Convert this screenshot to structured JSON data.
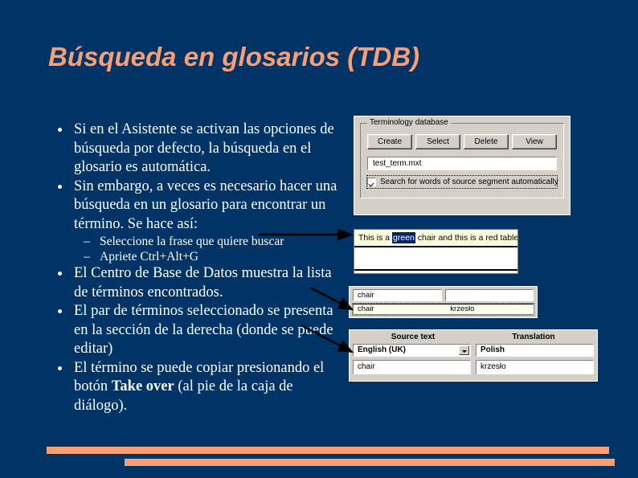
{
  "slide": {
    "title": "Búsqueda en glosarios (TDB)",
    "background_color": "#003366",
    "accent_color": "#FA9E73",
    "body_text_color": "#FFFFFF"
  },
  "body": {
    "bullets": [
      {
        "level": 1,
        "text": "Si en el Asistente se activan las opciones de búsqueda por defecto, la búsqueda en el glosario es automática."
      },
      {
        "level": 1,
        "text": "Sin embargo, a veces es necesario hacer una búsqueda en un glosario para encontrar un término. Se hace así:"
      },
      {
        "level": 2,
        "dash": "–",
        "text": "Seleccione la frase que quiere buscar"
      },
      {
        "level": 2,
        "dash": "–",
        "text": "Apriete Ctrl+Alt+G"
      },
      {
        "level": 1,
        "text": "El Centro de Base de Datos muestra la lista de términos encontrados."
      },
      {
        "level": 1,
        "text": "El par de términos seleccionado se presenta en la sección de la derecha (donde se puede editar)"
      },
      {
        "level": 1,
        "text_before": "El término se puede copiar presionando el botón ",
        "text_bold": "Take over",
        "text_after": " (al pie de la caja de diálogo)."
      }
    ]
  },
  "panel_termdb": {
    "group_legend": "Terminology database",
    "buttons": [
      {
        "label": "Create"
      },
      {
        "label": "Select"
      },
      {
        "label": "Delete"
      },
      {
        "label": "View"
      }
    ],
    "field_value": "test_term.mxt",
    "checkbox_label": "Search for words of source segment automatically",
    "checkbox_checked": true
  },
  "panel_segment": {
    "text_before": "This is a ",
    "text_selected": "green",
    "text_after": " chair and this is a red table",
    "selection_color": "#00246B",
    "line_background": "#FFFFDD"
  },
  "panel_results": {
    "search_box_value": "chair",
    "second_box_value": "",
    "row": {
      "source": "chair",
      "translation": "krzesło"
    }
  },
  "panel_editor": {
    "header_source": "Source text",
    "header_translation": "Translation",
    "source_language": "English (UK)",
    "target_language": "Polish",
    "source_value": "chair",
    "translation_value": "krzesło"
  },
  "arrows": {
    "count": 3,
    "color": "#000000"
  },
  "footer": {
    "bar_color": "#FA9E73"
  }
}
